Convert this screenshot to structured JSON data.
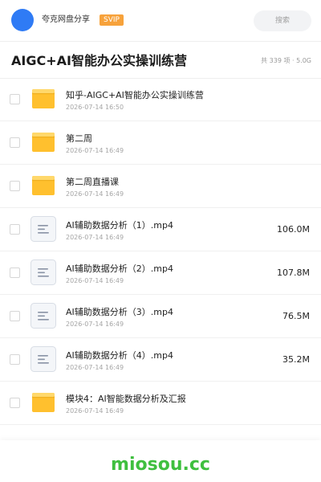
{
  "user": {
    "name": "夸克网盘分享",
    "badge": "SVIP"
  },
  "search": {
    "placeholder": "搜索"
  },
  "header": {
    "title": "AIGC+AI智能办公实操训练营",
    "summary": "共 339 项 · 5.0G"
  },
  "files": [
    {
      "name": "知乎-AIGC+AI智能办公实操训练营",
      "date": "2026-07-14 16:50",
      "type": "folder",
      "size": ""
    },
    {
      "name": "第二周",
      "date": "2026-07-14 16:49",
      "type": "folder",
      "size": ""
    },
    {
      "name": "第二周直播课",
      "date": "2026-07-14 16:49",
      "type": "folder",
      "size": ""
    },
    {
      "name": "AI辅助数据分析（1）.mp4",
      "date": "2026-07-14 16:49",
      "type": "file",
      "size": "106.0M"
    },
    {
      "name": "AI辅助数据分析（2）.mp4",
      "date": "2026-07-14 16:49",
      "type": "file",
      "size": "107.8M"
    },
    {
      "name": "AI辅助数据分析（3）.mp4",
      "date": "2026-07-14 16:49",
      "type": "file",
      "size": "76.5M"
    },
    {
      "name": "AI辅助数据分析（4）.mp4",
      "date": "2026-07-14 16:49",
      "type": "file",
      "size": "35.2M"
    },
    {
      "name": "模块4：AI智能数据分析及汇报",
      "date": "2026-07-14 16:49",
      "type": "folder",
      "size": ""
    }
  ],
  "watermark": "miosou.cc",
  "colors": {
    "accent": "#2f7bf5",
    "svip": "#f7a23b",
    "folder": "#ffc02e",
    "watermark": "#3fbf3f"
  }
}
